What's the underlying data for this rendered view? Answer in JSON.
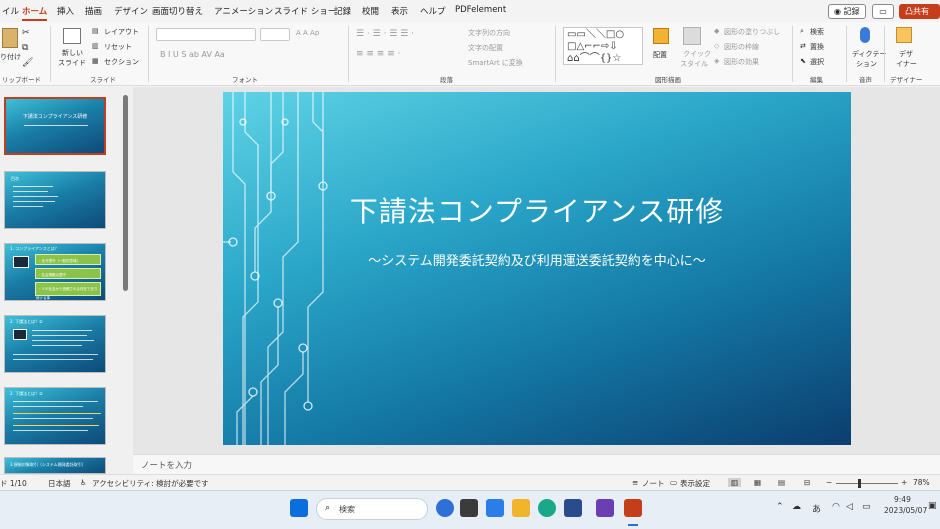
{
  "menubar": {
    "tabs": [
      "イル",
      "ホーム",
      "挿入",
      "描画",
      "デザイン",
      "画面切り替え",
      "アニメーション",
      "スライド ショー",
      "記録",
      "校閲",
      "表示",
      "ヘルプ",
      "PDFelement"
    ],
    "active": "ホーム",
    "record_label": "◉ 記録",
    "comment_icon": "comment-icon",
    "share_label": "凸共有"
  },
  "ribbon": {
    "paste_label": "り付け",
    "clipboard_group": "リップボード",
    "new_slide_label": "新しい",
    "new_slide_label2": "スライド",
    "layout_label": "レイアウト",
    "reset_label": "リセット",
    "section_label": "セクション",
    "slides_group": "スライド",
    "font_group": "フォント",
    "font_buttons": "B  I  U  S  ab  AV  Aa",
    "font_size_buttons": "A  A  Ap",
    "paragraph_group": "段落",
    "text_direction": "文字列の方向",
    "text_align": "文字の配置",
    "smartart": "SmartArt に変換",
    "arrange_label": "配置",
    "quick_style_label": "クイック",
    "quick_style_label2": "スタイル",
    "shape_fill": "図形の塗りつぶし",
    "shape_outline": "図形の枠線",
    "shape_effect": "図形の効果",
    "drawing_group": "図形描画",
    "find_label": "検索",
    "replace_label": "置換",
    "select_label": "選択",
    "editing_group": "編集",
    "dictate_label": "ディクテー",
    "dictate_label2": "ション",
    "voice_group": "音声",
    "designer_label": "デザ",
    "designer_label2": "イナー",
    "designer_group": "デザイナー"
  },
  "thumbnails": [
    {
      "number": 1,
      "title": "下請法コンプライアンス研修"
    },
    {
      "number": 2,
      "title": "目次"
    },
    {
      "number": 3,
      "title": "1. コンプライアンスとは？",
      "boxes": [
        "・法令遵守（一般的意味）",
        "・社会規範の遵守",
        "・人や社会から信頼される存在であり続ける事"
      ]
    },
    {
      "number": 4,
      "title": "2. 下請法とは？①"
    },
    {
      "number": 5,
      "title": "2. 下請法とは？②"
    },
    {
      "number": 6,
      "title": "3.規制対象取引（システム開発委託取引）"
    }
  ],
  "slide": {
    "title": "下請法コンプライアンス研修",
    "subtitle": "～システム開発委託契約及び利用運送委託契約を中心に～"
  },
  "notes": {
    "placeholder": "ノートを入力"
  },
  "status": {
    "slide_counter": "ド 1/10",
    "language": "日本語",
    "accessibility": "アクセシビリティ: 検討が必要です",
    "notes_btn": "ノート",
    "display_settings": "表示設定",
    "zoom": "78%"
  },
  "taskbar": {
    "search_placeholder": "検索",
    "ime": "あ",
    "time": "9:49",
    "date": "2023/05/07",
    "colors": {
      "accent": "#c43e1c",
      "slide_dark": "#0b3e6e",
      "slide_light": "#5fd3e6"
    }
  }
}
